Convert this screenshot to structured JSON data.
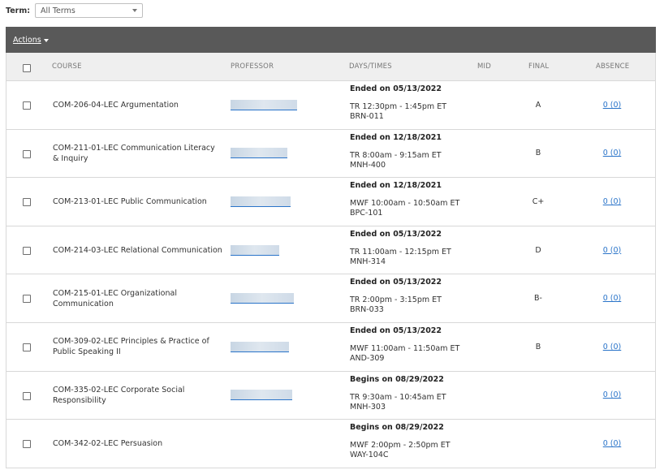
{
  "term": {
    "label": "Term:",
    "selected": "All Terms"
  },
  "toolbar": {
    "actions_label": "Actions"
  },
  "columns": {
    "course": "COURSE",
    "professor": "PROFESSOR",
    "days_times": "DAYS/TIMES",
    "mid": "MID",
    "final": "FINAL",
    "absence": "ABSENCE"
  },
  "rows": [
    {
      "course": "COM-206-04-LEC Argumentation",
      "status": "Ended on 05/13/2022",
      "schedule": "TR 12:30pm - 1:45pm ET",
      "room": "BRN-011",
      "mid": "",
      "final": "A",
      "absence": "0 (0)"
    },
    {
      "course": "COM-211-01-LEC Communication Literacy & Inquiry",
      "status": "Ended on 12/18/2021",
      "schedule": "TR 8:00am - 9:15am ET",
      "room": "MNH-400",
      "mid": "",
      "final": "B",
      "absence": "0 (0)"
    },
    {
      "course": "COM-213-01-LEC Public Communication",
      "status": "Ended on 12/18/2021",
      "schedule": "MWF 10:00am - 10:50am ET",
      "room": "BPC-101",
      "mid": "",
      "final": "C+",
      "absence": "0 (0)"
    },
    {
      "course": "COM-214-03-LEC Relational Communication",
      "status": "Ended on 05/13/2022",
      "schedule": "TR 11:00am - 12:15pm ET",
      "room": "MNH-314",
      "mid": "",
      "final": "D",
      "absence": "0 (0)"
    },
    {
      "course": "COM-215-01-LEC Organizational Communication",
      "status": "Ended on 05/13/2022",
      "schedule": "TR 2:00pm - 3:15pm ET",
      "room": "BRN-033",
      "mid": "",
      "final": "B-",
      "absence": "0 (0)"
    },
    {
      "course": "COM-309-02-LEC Principles & Practice of Public Speaking II",
      "status": "Ended on 05/13/2022",
      "schedule": "MWF 11:00am - 11:50am ET",
      "room": "AND-309",
      "mid": "",
      "final": "B",
      "absence": "0 (0)"
    },
    {
      "course": "COM-335-02-LEC Corporate Social Responsibility",
      "status": "Begins on 08/29/2022",
      "schedule": "TR 9:30am - 10:45am ET",
      "room": "MNH-303",
      "mid": "",
      "final": "",
      "absence": "0 (0)"
    },
    {
      "course": "COM-342-02-LEC Persuasion",
      "status": "Begins on 08/29/2022",
      "schedule": "MWF 2:00pm - 2:50pm ET",
      "room": "WAY-104C",
      "mid": "",
      "final": "",
      "absence": "0 (0)"
    }
  ],
  "colors": {
    "toolbar_bg": "#595959",
    "header_bg": "#efefef",
    "link": "#2a74c9"
  }
}
